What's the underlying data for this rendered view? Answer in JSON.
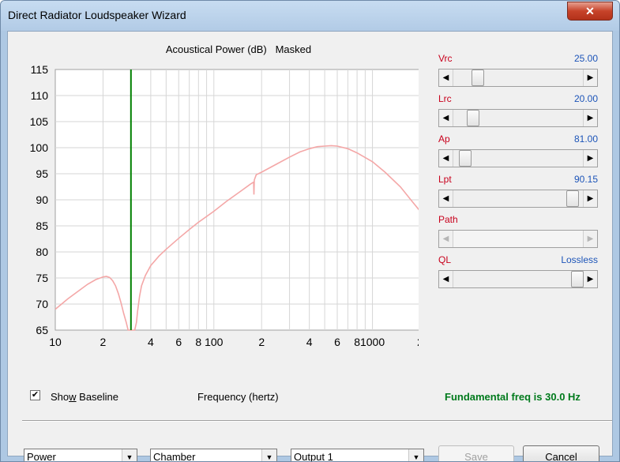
{
  "window": {
    "title": "Direct Radiator Loudspeaker Wizard",
    "close_glyph": "✕"
  },
  "chart_data": {
    "type": "line",
    "title": "Acoustical Power (dB)   Masked",
    "xlabel": "Frequency (hertz)",
    "ylabel": "",
    "xscale": "log",
    "xlim": [
      10,
      2000
    ],
    "ylim": [
      65,
      115
    ],
    "y_ticks": [
      "115",
      "110",
      "105",
      "100",
      "95",
      "90",
      "85",
      "80",
      "75",
      "70",
      "65"
    ],
    "x_ticks": [
      {
        "value": 10,
        "label": "10"
      },
      {
        "value": 20,
        "label": "2"
      },
      {
        "value": 40,
        "label": "4"
      },
      {
        "value": 60,
        "label": "6"
      },
      {
        "value": 80,
        "label": "8"
      },
      {
        "value": 100,
        "label": "100"
      },
      {
        "value": 200,
        "label": "2"
      },
      {
        "value": 400,
        "label": "4"
      },
      {
        "value": 600,
        "label": "6"
      },
      {
        "value": 800,
        "label": "8"
      },
      {
        "value": 1000,
        "label": "1000"
      },
      {
        "value": 2000,
        "label": "2"
      }
    ],
    "grid": true,
    "marker_line": {
      "x": 30,
      "color": "#008000"
    },
    "series": [
      {
        "color": "#f4a7a7",
        "points": [
          [
            10,
            69.0
          ],
          [
            12,
            71.0
          ],
          [
            14,
            72.5
          ],
          [
            16,
            73.8
          ],
          [
            18,
            74.7
          ],
          [
            20,
            75.2
          ],
          [
            21,
            75.3
          ],
          [
            22,
            75.1
          ],
          [
            23,
            74.5
          ],
          [
            24,
            73.5
          ],
          [
            25,
            72.0
          ],
          [
            26,
            70.2
          ],
          [
            27,
            68.2
          ],
          [
            28,
            66.5
          ],
          [
            28.8,
            65.0
          ],
          [
            31.7,
            65.0
          ],
          [
            32.5,
            66.5
          ],
          [
            33,
            68.5
          ],
          [
            34,
            71.5
          ],
          [
            35,
            73.5
          ],
          [
            37,
            75.5
          ],
          [
            40,
            77.4
          ],
          [
            45,
            79.2
          ],
          [
            50,
            80.5
          ],
          [
            60,
            82.6
          ],
          [
            70,
            84.3
          ],
          [
            80,
            85.7
          ],
          [
            100,
            87.8
          ],
          [
            120,
            89.7
          ],
          [
            150,
            91.8
          ],
          [
            170,
            93.0
          ],
          [
            178,
            93.4
          ],
          [
            179,
            91.0
          ],
          [
            180,
            93.8
          ],
          [
            185,
            94.8
          ],
          [
            200,
            95.3
          ],
          [
            250,
            96.9
          ],
          [
            300,
            98.2
          ],
          [
            350,
            99.2
          ],
          [
            400,
            99.8
          ],
          [
            450,
            100.2
          ],
          [
            500,
            100.3
          ],
          [
            550,
            100.4
          ],
          [
            600,
            100.3
          ],
          [
            700,
            99.8
          ],
          [
            800,
            99.0
          ],
          [
            1000,
            97.3
          ],
          [
            1200,
            95.3
          ],
          [
            1500,
            92.5
          ],
          [
            1800,
            89.5
          ],
          [
            2000,
            87.8
          ]
        ]
      }
    ]
  },
  "sliders": [
    {
      "name": "Vrc",
      "value": "25.00",
      "position": 0.16,
      "enabled": true
    },
    {
      "name": "Lrc",
      "value": "20.00",
      "position": 0.12,
      "enabled": true
    },
    {
      "name": "Ap",
      "value": "81.00",
      "position": 0.05,
      "enabled": true
    },
    {
      "name": "Lpt",
      "value": "90.15",
      "position": 0.96,
      "enabled": true
    },
    {
      "name": "Path",
      "value": "",
      "position": null,
      "enabled": false
    },
    {
      "name": "QL",
      "value": "Lossless",
      "position": 1.0,
      "enabled": true
    }
  ],
  "show_baseline": {
    "label_pre": "Sho",
    "label_key": "w",
    "label_post": " Baseline",
    "checked": true,
    "check_glyph": "✔"
  },
  "fundamental_text": "Fundamental freq is 30.0 Hz",
  "combos": [
    {
      "value": "Power"
    },
    {
      "value": "Chamber"
    },
    {
      "value": "Output 1"
    }
  ],
  "buttons": {
    "save": "Save",
    "cancel": "Cancel"
  },
  "arrows": {
    "left": "◀",
    "right": "▶",
    "down": "▼"
  },
  "colors": {
    "slider_name": "#c8001c",
    "slider_value": "#1c54b8",
    "fundamental": "#007a1c"
  }
}
